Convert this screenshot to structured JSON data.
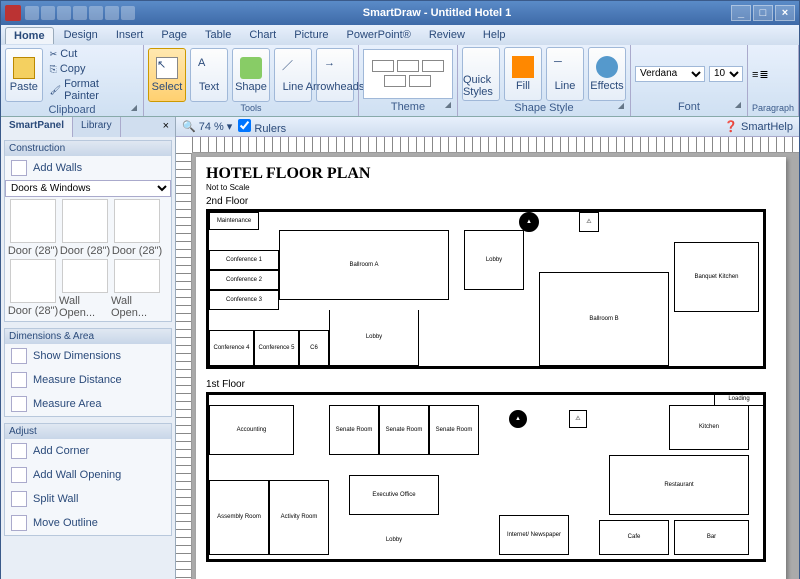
{
  "title": "SmartDraw - Untitled Hotel 1",
  "menu": [
    "Home",
    "Design",
    "Insert",
    "Page",
    "Table",
    "Chart",
    "Picture",
    "PowerPoint®",
    "Review",
    "Help"
  ],
  "ribbon": {
    "clipboard": {
      "label": "Clipboard",
      "paste": "Paste",
      "cut": "Cut",
      "copy": "Copy",
      "fmt": "Format Painter"
    },
    "tools": {
      "label": "Tools",
      "select": "Select",
      "text": "Text",
      "shape": "Shape",
      "line": "Line",
      "arrow": "Arrowheads"
    },
    "theme": {
      "label": "Theme"
    },
    "shape_style": {
      "label": "Shape Style",
      "quick": "Quick Styles",
      "fill": "Fill",
      "line": "Line",
      "effects": "Effects"
    },
    "font": {
      "label": "Font",
      "family": "Verdana",
      "size": "10"
    },
    "para": {
      "label": "Paragraph"
    }
  },
  "left": {
    "tabs": [
      "SmartPanel",
      "Library"
    ],
    "construction": {
      "hdr": "Construction",
      "add_walls": "Add Walls",
      "combo": "Doors & Windows",
      "shapes": [
        "Door (28\")",
        "Door (28\")",
        "Door (28\")",
        "Door (28\")",
        "Wall Open...",
        "Wall Open..."
      ]
    },
    "dims": {
      "hdr": "Dimensions & Area",
      "items": [
        "Show Dimensions",
        "Measure Distance",
        "Measure Area"
      ]
    },
    "adjust": {
      "hdr": "Adjust",
      "items": [
        "Add Corner",
        "Add Wall Opening",
        "Split Wall",
        "Move Outline"
      ]
    }
  },
  "canvas": {
    "zoom": "74 %",
    "rulers": "Rulers",
    "help": "SmartHelp",
    "doc_title": "HOTEL FLOOR PLAN",
    "subtitle": "Not to Scale",
    "floor2": "2nd Floor",
    "floor1": "1st Floor"
  },
  "rooms2": {
    "maint": "Maintenance",
    "conf1": "Conference 1",
    "conf2": "Conference 2",
    "conf3": "Conference 3",
    "conf4": "Conference 4",
    "conf5": "Conference 5",
    "c6": "C6",
    "ballA": "Ballroom A",
    "ballB": "Ballroom B",
    "lobby": "Lobby",
    "lobby2": "Lobby",
    "banquet": "Banquet Kitchen"
  },
  "rooms1": {
    "acct": "Accounting",
    "assembly": "Assembly Room",
    "activity": "Activity Room",
    "senate": "Senate Room",
    "senate2": "Senate Room",
    "senate3": "Senate Room",
    "exec": "Executive Office",
    "lobby": "Lobby",
    "internet": "Internet/ Newspaper",
    "kitchen": "Kitchen",
    "rest": "Restaurant",
    "cafe": "Cafe",
    "bar": "Bar",
    "loading": "Loading"
  }
}
